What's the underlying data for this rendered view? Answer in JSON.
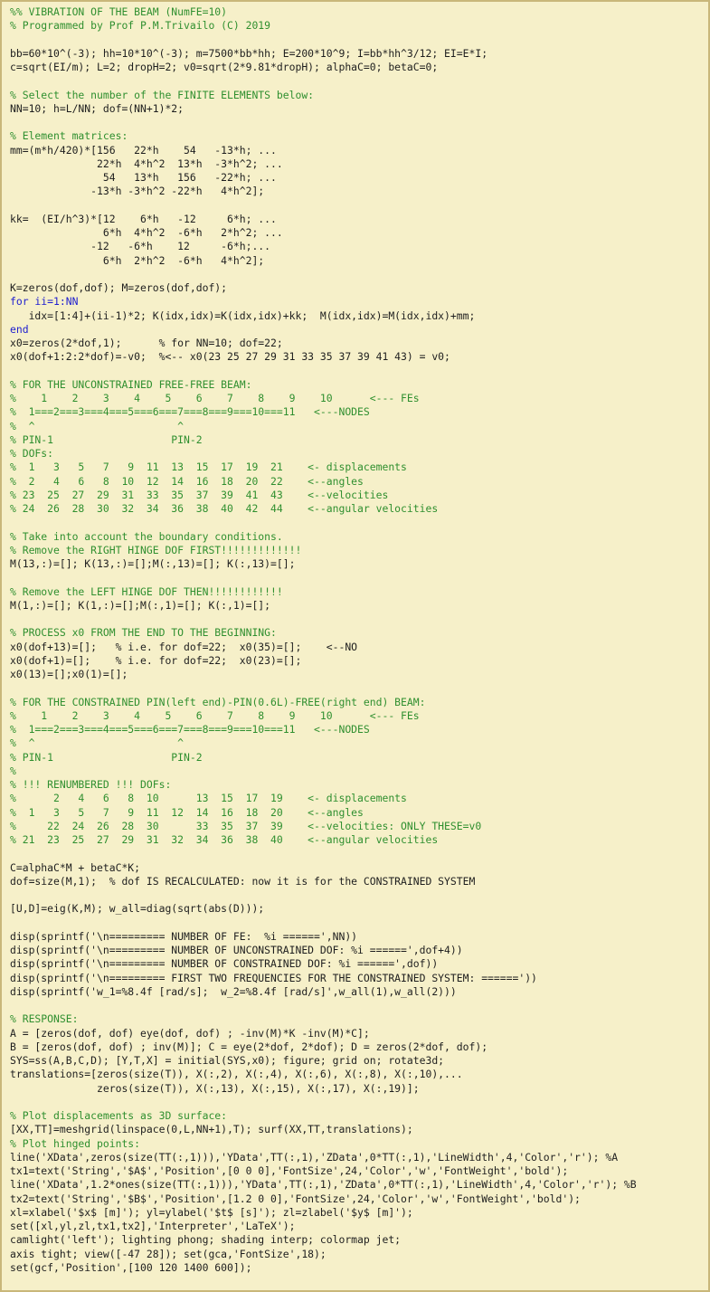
{
  "editor": {
    "lines": [
      {
        "text": "%% VIBRATION OF THE BEAM (NumFE=10)",
        "kind": "comment"
      },
      {
        "text": "% Programmed by Prof P.M.Trivailo (C) 2019",
        "kind": "comment"
      },
      {
        "text": "",
        "kind": "plain"
      },
      {
        "text": "bb=60*10^(-3); hh=10*10^(-3); m=7500*bb*hh; E=200*10^9; I=bb*hh^3/12; EI=E*I;",
        "kind": "plain"
      },
      {
        "text": "c=sqrt(EI/m); L=2; dropH=2; v0=sqrt(2*9.81*dropH); alphaC=0; betaC=0;",
        "kind": "plain"
      },
      {
        "text": "",
        "kind": "plain"
      },
      {
        "text": "% Select the number of the FINITE ELEMENTS below:",
        "kind": "comment"
      },
      {
        "text": "NN=10; h=L/NN; dof=(NN+1)*2;",
        "kind": "plain"
      },
      {
        "text": "",
        "kind": "plain"
      },
      {
        "text": "% Element matrices:",
        "kind": "comment"
      },
      {
        "text": "mm=(m*h/420)*[156   22*h    54   -13*h; ...",
        "kind": "plain"
      },
      {
        "text": "              22*h  4*h^2  13*h  -3*h^2; ...",
        "kind": "plain"
      },
      {
        "text": "               54   13*h   156   -22*h; ...",
        "kind": "plain"
      },
      {
        "text": "             -13*h -3*h^2 -22*h   4*h^2];",
        "kind": "plain"
      },
      {
        "text": "",
        "kind": "plain"
      },
      {
        "text": "kk=  (EI/h^3)*[12    6*h   -12     6*h; ...",
        "kind": "plain"
      },
      {
        "text": "               6*h  4*h^2  -6*h   2*h^2; ...",
        "kind": "plain"
      },
      {
        "text": "             -12   -6*h    12     -6*h;...",
        "kind": "plain"
      },
      {
        "text": "               6*h  2*h^2  -6*h   4*h^2];",
        "kind": "plain"
      },
      {
        "text": "",
        "kind": "plain"
      },
      {
        "text": "K=zeros(dof,dof); M=zeros(dof,dof);",
        "kind": "plain"
      },
      {
        "text": "for ii=1:NN",
        "kind": "keyword"
      },
      {
        "text": "   idx=[1:4]+(ii-1)*2; K(idx,idx)=K(idx,idx)+kk;  M(idx,idx)=M(idx,idx)+mm;",
        "kind": "plain"
      },
      {
        "text": "end",
        "kind": "keyword"
      },
      {
        "text": "x0=zeros(2*dof,1);      % for NN=10; dof=22;",
        "kind": "plain"
      },
      {
        "text": "x0(dof+1:2:2*dof)=-v0;  %<-- x0(23 25 27 29 31 33 35 37 39 41 43) = v0;",
        "kind": "plain"
      },
      {
        "text": "",
        "kind": "plain"
      },
      {
        "text": "% FOR THE UNCONSTRAINED FREE-FREE BEAM:",
        "kind": "comment"
      },
      {
        "text": "%    1    2    3    4    5    6    7    8    9    10      <--- FEs",
        "kind": "comment"
      },
      {
        "text": "%  1===2===3===4===5===6===7===8===9===10===11   <---NODES",
        "kind": "comment"
      },
      {
        "text": "%  ^                       ^",
        "kind": "comment"
      },
      {
        "text": "% PIN-1                   PIN-2",
        "kind": "comment"
      },
      {
        "text": "% DOFs:",
        "kind": "comment"
      },
      {
        "text": "%  1   3   5   7   9  11  13  15  17  19  21    <- displacements",
        "kind": "comment"
      },
      {
        "text": "%  2   4   6   8  10  12  14  16  18  20  22    <--angles",
        "kind": "comment"
      },
      {
        "text": "% 23  25  27  29  31  33  35  37  39  41  43    <--velocities",
        "kind": "comment"
      },
      {
        "text": "% 24  26  28  30  32  34  36  38  40  42  44    <--angular velocities",
        "kind": "comment"
      },
      {
        "text": "",
        "kind": "plain"
      },
      {
        "text": "% Take into account the boundary conditions.",
        "kind": "comment"
      },
      {
        "text": "% Remove the RIGHT HINGE DOF FIRST!!!!!!!!!!!!!",
        "kind": "comment"
      },
      {
        "text": "M(13,:)=[]; K(13,:)=[];M(:,13)=[]; K(:,13)=[];",
        "kind": "plain"
      },
      {
        "text": "",
        "kind": "plain"
      },
      {
        "text": "% Remove the LEFT HINGE DOF THEN!!!!!!!!!!!!",
        "kind": "comment"
      },
      {
        "text": "M(1,:)=[]; K(1,:)=[];M(:,1)=[]; K(:,1)=[];",
        "kind": "plain"
      },
      {
        "text": "",
        "kind": "plain"
      },
      {
        "text": "% PROCESS x0 FROM THE END TO THE BEGINNING:",
        "kind": "comment"
      },
      {
        "text": "x0(dof+13)=[];   % i.e. for dof=22;  x0(35)=[];    <--NO",
        "kind": "plain"
      },
      {
        "text": "x0(dof+1)=[];    % i.e. for dof=22;  x0(23)=[];",
        "kind": "plain"
      },
      {
        "text": "x0(13)=[];x0(1)=[];",
        "kind": "plain"
      },
      {
        "text": "",
        "kind": "plain"
      },
      {
        "text": "% FOR THE CONSTRAINED PIN(left end)-PIN(0.6L)-FREE(right end) BEAM:",
        "kind": "comment"
      },
      {
        "text": "%    1    2    3    4    5    6    7    8    9    10      <--- FEs",
        "kind": "comment"
      },
      {
        "text": "%  1===2===3===4===5===6===7===8===9===10===11   <---NODES",
        "kind": "comment"
      },
      {
        "text": "%  ^                       ^",
        "kind": "comment"
      },
      {
        "text": "% PIN-1                   PIN-2",
        "kind": "comment"
      },
      {
        "text": "%",
        "kind": "comment"
      },
      {
        "text": "% !!! RENUMBERED !!! DOFs:",
        "kind": "comment"
      },
      {
        "text": "%      2   4   6   8  10      13  15  17  19    <- displacements",
        "kind": "comment"
      },
      {
        "text": "%  1   3   5   7   9  11  12  14  16  18  20    <--angles",
        "kind": "comment"
      },
      {
        "text": "%     22  24  26  28  30      33  35  37  39    <--velocities: ONLY THESE=v0",
        "kind": "comment"
      },
      {
        "text": "% 21  23  25  27  29  31  32  34  36  38  40    <--angular velocities",
        "kind": "comment"
      },
      {
        "text": "",
        "kind": "plain"
      },
      {
        "text": "C=alphaC*M + betaC*K;",
        "kind": "plain"
      },
      {
        "text": "dof=size(M,1);  % dof IS RECALCULATED: now it is for the CONSTRAINED SYSTEM",
        "kind": "plain"
      },
      {
        "text": "",
        "kind": "plain"
      },
      {
        "text": "[U,D]=eig(K,M); w_all=diag(sqrt(abs(D)));",
        "kind": "plain"
      },
      {
        "text": "",
        "kind": "plain"
      },
      {
        "text": "disp(sprintf('\\n========= NUMBER OF FE:  %i ======',NN))",
        "kind": "plain"
      },
      {
        "text": "disp(sprintf('\\n========= NUMBER OF UNCONSTRAINED DOF: %i ======',dof+4))",
        "kind": "plain"
      },
      {
        "text": "disp(sprintf('\\n========= NUMBER OF CONSTRAINED DOF: %i ======',dof))",
        "kind": "plain"
      },
      {
        "text": "disp(sprintf('\\n========= FIRST TWO FREQUENCIES FOR THE CONSTRAINED SYSTEM: ======'))",
        "kind": "plain"
      },
      {
        "text": "disp(sprintf('w_1=%8.4f [rad/s];  w_2=%8.4f [rad/s]',w_all(1),w_all(2)))",
        "kind": "plain"
      },
      {
        "text": "",
        "kind": "plain"
      },
      {
        "text": "% RESPONSE:",
        "kind": "comment"
      },
      {
        "text": "A = [zeros(dof, dof) eye(dof, dof) ; -inv(M)*K -inv(M)*C];",
        "kind": "plain"
      },
      {
        "text": "B = [zeros(dof, dof) ; inv(M)]; C = eye(2*dof, 2*dof); D = zeros(2*dof, dof);",
        "kind": "plain"
      },
      {
        "text": "SYS=ss(A,B,C,D); [Y,T,X] = initial(SYS,x0); figure; grid on; rotate3d;",
        "kind": "plain"
      },
      {
        "text": "translations=[zeros(size(T)), X(:,2), X(:,4), X(:,6), X(:,8), X(:,10),...",
        "kind": "plain"
      },
      {
        "text": "              zeros(size(T)), X(:,13), X(:,15), X(:,17), X(:,19)];",
        "kind": "plain"
      },
      {
        "text": "",
        "kind": "plain"
      },
      {
        "text": "% Plot displacements as 3D surface:",
        "kind": "comment"
      },
      {
        "text": "[XX,TT]=meshgrid(linspace(0,L,NN+1),T); surf(XX,TT,translations);",
        "kind": "plain"
      },
      {
        "text": "% Plot hinged points:",
        "kind": "comment"
      },
      {
        "text": "line('XData',zeros(size(TT(:,1))),'YData',TT(:,1),'ZData',0*TT(:,1),'LineWidth',4,'Color','r'); %A",
        "kind": "plain"
      },
      {
        "text": "tx1=text('String','$A$','Position',[0 0 0],'FontSize',24,'Color','w','FontWeight','bold');",
        "kind": "plain"
      },
      {
        "text": "line('XData',1.2*ones(size(TT(:,1))),'YData',TT(:,1),'ZData',0*TT(:,1),'LineWidth',4,'Color','r'); %B",
        "kind": "plain"
      },
      {
        "text": "tx2=text('String','$B$','Position',[1.2 0 0],'FontSize',24,'Color','w','FontWeight','bold');",
        "kind": "plain"
      },
      {
        "text": "xl=xlabel('$x$ [m]'); yl=ylabel('$t$ [s]'); zl=zlabel('$y$ [m]');",
        "kind": "plain"
      },
      {
        "text": "set([xl,yl,zl,tx1,tx2],'Interpreter','LaTeX');",
        "kind": "plain"
      },
      {
        "text": "camlight('left'); lighting phong; shading interp; colormap jet;",
        "kind": "plain"
      },
      {
        "text": "axis tight; view([-47 28]); set(gca,'FontSize',18);",
        "kind": "plain"
      },
      {
        "text": "set(gcf,'Position',[100 120 1400 600]);",
        "kind": "plain"
      }
    ]
  }
}
